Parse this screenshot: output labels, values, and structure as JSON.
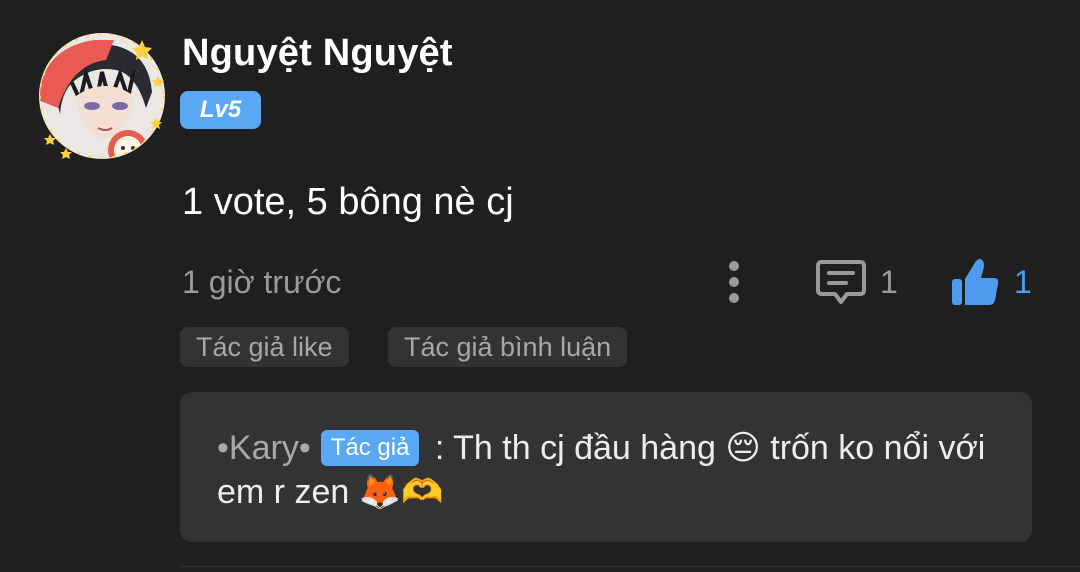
{
  "comment": {
    "username": "Nguyệt Nguyệt",
    "level": "Lv5",
    "text": "1 vote, 5 bông nè cj",
    "timestamp": "1 giờ trước",
    "reply_count": "1",
    "like_count": "1",
    "icons": {
      "more": "more-vertical-icon",
      "reply": "comment-bubble-icon",
      "like": "thumbs-up-icon"
    },
    "tags": [
      "Tác giả like",
      "Tác giả bình luận"
    ]
  },
  "reply": {
    "author": "•Kary•",
    "author_badge": "Tác giả",
    "separator": " : ",
    "text_part1": "Th th cj đầu hàng ",
    "emoji_sad": "😔",
    "text_part2": " trốn ko nổi với em r zen ",
    "emoji_fox": "🦊",
    "emoji_heart_hands": "🫶"
  },
  "colors": {
    "background": "#1f1f1f",
    "accent_blue": "#5aa8f4",
    "like_blue": "#4f9bf0",
    "muted_text": "#9a9a9a",
    "chip_background": "#333333"
  }
}
